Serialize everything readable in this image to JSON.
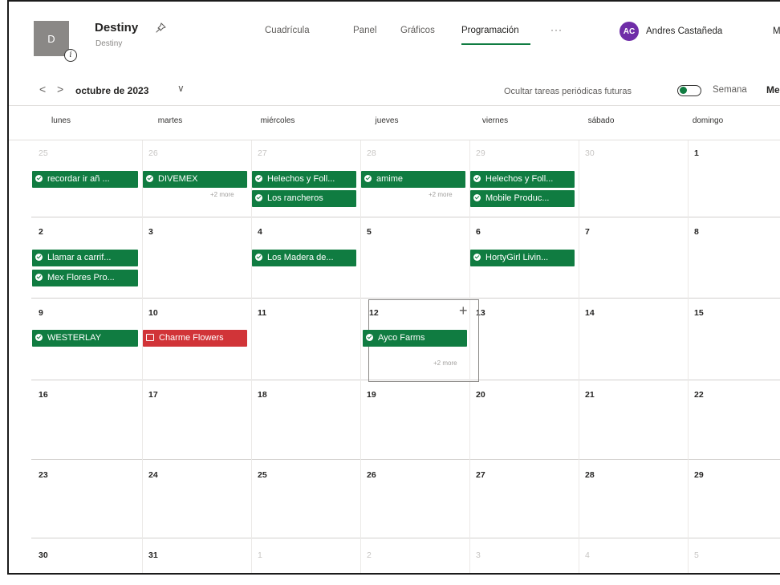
{
  "plan": {
    "avatar_letter": "D",
    "title": "Destiny",
    "subtitle": "Destiny",
    "info_glyph": "i"
  },
  "tabs": [
    {
      "label": "Cuadrícula"
    },
    {
      "label": "Panel"
    },
    {
      "label": "Gráficos"
    },
    {
      "label": "Programación",
      "active": true
    }
  ],
  "more_tabs_label": "···",
  "user": {
    "initials": "AC",
    "name": "Andres Castañeda",
    "avatar_color": "#6f2da8",
    "truncated_next": "M"
  },
  "toolbar": {
    "prev_glyph": "<",
    "next_glyph": ">",
    "month_label": "octubre de 2023",
    "chevron_glyph": "∨",
    "hide_future_label": "Ocultar tareas periódicas futuras",
    "hide_future_on": true,
    "week_label": "Semana",
    "month_btn_label": "Me"
  },
  "weekdays": [
    "lunes",
    "martes",
    "miércoles",
    "jueves",
    "viernes",
    "sábado",
    "domingo"
  ],
  "weeks": [
    {
      "days": [
        {
          "num": "25",
          "dim": true
        },
        {
          "num": "26",
          "dim": true
        },
        {
          "num": "27",
          "dim": true
        },
        {
          "num": "28",
          "dim": true
        },
        {
          "num": "29",
          "dim": true
        },
        {
          "num": "30",
          "dim": true
        },
        {
          "num": "1",
          "dim": false
        }
      ]
    },
    {
      "days": [
        {
          "num": "2"
        },
        {
          "num": "3"
        },
        {
          "num": "4"
        },
        {
          "num": "5"
        },
        {
          "num": "6"
        },
        {
          "num": "7"
        },
        {
          "num": "8"
        }
      ]
    },
    {
      "days": [
        {
          "num": "9"
        },
        {
          "num": "10"
        },
        {
          "num": "11"
        },
        {
          "num": "12"
        },
        {
          "num": "13"
        },
        {
          "num": "14"
        },
        {
          "num": "15"
        }
      ]
    },
    {
      "days": [
        {
          "num": "16"
        },
        {
          "num": "17"
        },
        {
          "num": "18"
        },
        {
          "num": "19"
        },
        {
          "num": "20"
        },
        {
          "num": "21"
        },
        {
          "num": "22"
        }
      ]
    },
    {
      "days": [
        {
          "num": "23"
        },
        {
          "num": "24"
        },
        {
          "num": "25"
        },
        {
          "num": "26"
        },
        {
          "num": "27"
        },
        {
          "num": "28"
        },
        {
          "num": "29"
        }
      ]
    },
    {
      "days": [
        {
          "num": "30"
        },
        {
          "num": "31"
        },
        {
          "num": "1",
          "dim": true
        },
        {
          "num": "2",
          "dim": true
        },
        {
          "num": "3",
          "dim": true
        },
        {
          "num": "4",
          "dim": true
        },
        {
          "num": "5",
          "dim": true
        }
      ]
    }
  ],
  "tasks": {
    "w1_mon": "recordar ir añ ...",
    "w1_tue": "DIVEMEX",
    "w1_wed_1": "Helechos y Foll...",
    "w1_wed_2": "Los rancheros",
    "w1_thu": "amime",
    "w1_fri_1": "Helechos y Foll...",
    "w1_fri_2": "Mobile Produc...",
    "w2_mon_1": "Llamar a carrif...",
    "w2_mon_2": "Mex Flores Pro...",
    "w2_wed": "Los Madera de...",
    "w2_fri": "HortyGirl Livin...",
    "w3_mon": "WESTERLAY",
    "w3_tue": "Charme Flowers",
    "w3_thu": "Ayco Farms"
  },
  "more_labels": {
    "w1_tue": "+2 more",
    "w1_thu": "+2 more",
    "w3_thu": "+2 more"
  },
  "today_add_glyph": "+",
  "colors": {
    "task_green": "#107c41",
    "task_red": "#d13438",
    "accent": "#107c41"
  }
}
